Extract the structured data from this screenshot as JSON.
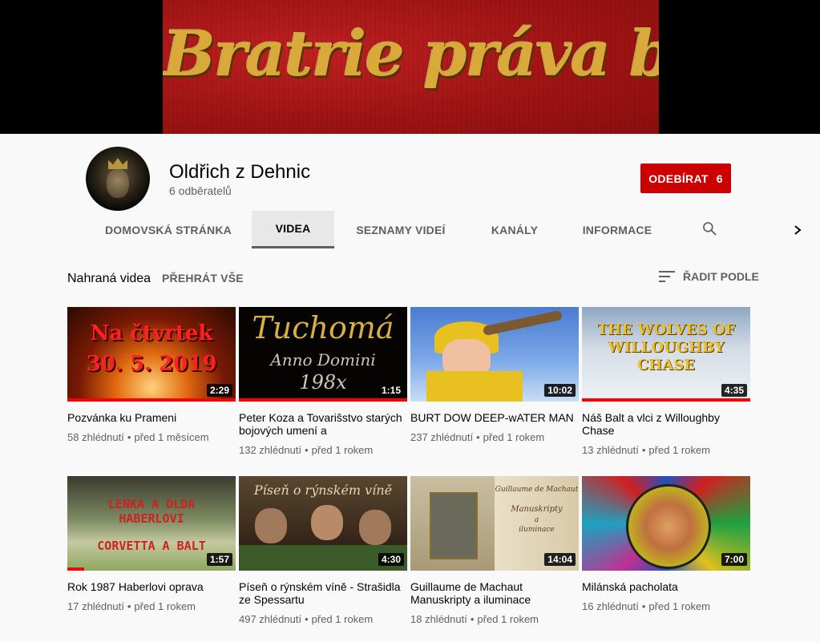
{
  "banner": {
    "title": "Bratrie práva božiého"
  },
  "channel": {
    "name": "Oldřich z Dehnic",
    "subscribers": "6 odběratelů",
    "subscribe_label": "ODEBÍRAT",
    "subscribe_count": "6"
  },
  "tabs": [
    {
      "label": "DOMOVSKÁ STRÁNKA"
    },
    {
      "label": "VIDEA"
    },
    {
      "label": "SEZNAMY VIDEÍ"
    },
    {
      "label": "KANÁLY"
    },
    {
      "label": "INFORMACE"
    }
  ],
  "section": {
    "title": "Nahraná videa",
    "play_all": "PŘEHRÁT VŠE",
    "sort_label": "ŘADIT PODLE"
  },
  "videos": [
    {
      "title": "Pozvánka ku Prameni",
      "views": "58 zhlédnutí",
      "age": "před 1 měsícem",
      "duration": "2:29",
      "thumb_text": [
        "Na čtvrtek",
        "30. 5. 2019"
      ],
      "watched": 1.0
    },
    {
      "title": "Peter Koza a Tovariŝstvo starých bojových umení a",
      "views": "132 zhlédnutí",
      "age": "před 1 rokem",
      "duration": "1:15",
      "thumb_text": [
        "Tuchomá",
        "Anno Domini",
        "198x"
      ],
      "watched": 1.0
    },
    {
      "title": "BURT DOW DEEP-wATER MAN",
      "views": "237 zhlédnutí",
      "age": "před 1 rokem",
      "duration": "10:02",
      "thumb_text": [],
      "watched": 0
    },
    {
      "title": "Náš Balt a vlci z Willoughby Chase",
      "views": "13 zhlédnutí",
      "age": "před 1 rokem",
      "duration": "4:35",
      "thumb_text": [
        "THE WOLVES OF",
        "WILLOUGHBY",
        "CHASE"
      ],
      "watched": 1.0
    },
    {
      "title": "Rok 1987 Haberlovi oprava",
      "views": "17 zhlédnutí",
      "age": "před 1 rokem",
      "duration": "1:57",
      "thumb_text": [
        "LENKA A OLDA",
        "HABERLOVI",
        "CORVETTA A BALT"
      ],
      "watched": 0.1
    },
    {
      "title": "Píseň o rýnském víně - Strašidla ze Spessartu",
      "views": "497 zhlédnutí",
      "age": "před 1 rokem",
      "duration": "4:30",
      "thumb_text": [
        "Píseň o rýnském víně"
      ],
      "watched": 0
    },
    {
      "title": "Guillaume de Machaut Manuskripty a iluminace",
      "views": "18 zhlédnutí",
      "age": "před 1 rokem",
      "duration": "14:04",
      "thumb_text": [
        "Guillaume de Machaut",
        "Manuskripty",
        "a",
        "iluminace"
      ],
      "watched": 0
    },
    {
      "title": "Milánská pacholata",
      "views": "16 zhlédnutí",
      "age": "před 1 rokem",
      "duration": "7:00",
      "thumb_text": [],
      "watched": 0
    }
  ]
}
